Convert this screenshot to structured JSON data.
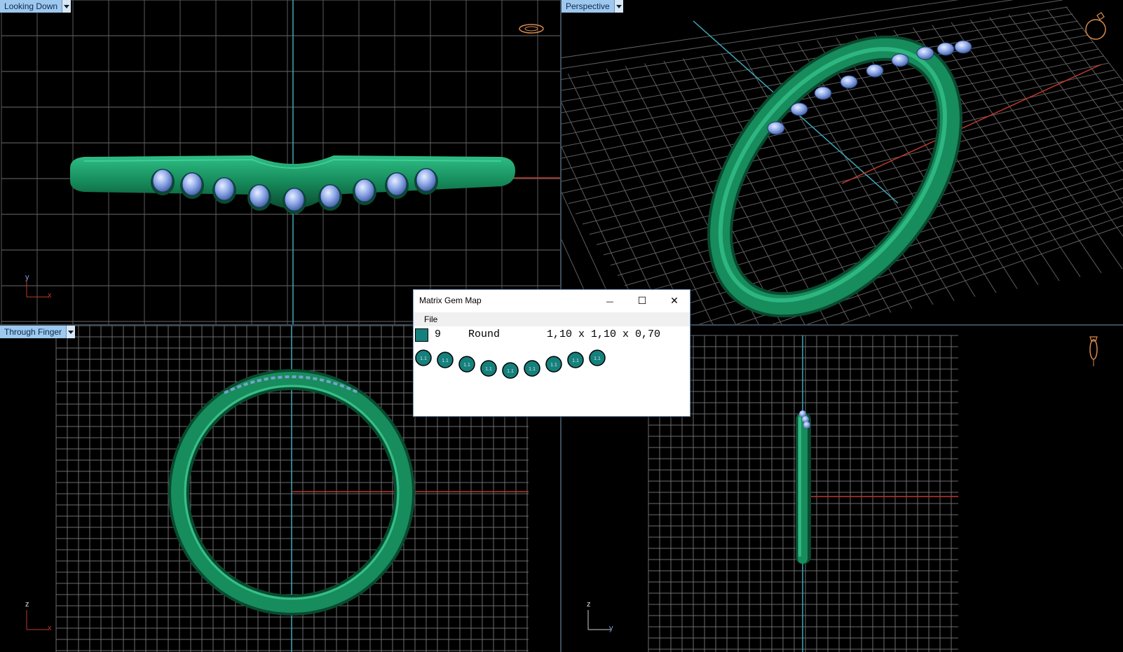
{
  "viewports": {
    "top_left": {
      "label": "Looking Down",
      "axes": {
        "v": "y",
        "h": "x"
      }
    },
    "top_right": {
      "label": "Perspective"
    },
    "bottom_left": {
      "label": "Through Finger",
      "axes": {
        "v": "z",
        "h": "x"
      }
    },
    "bottom_right": {
      "axes": {
        "v": "z",
        "h": "y"
      }
    }
  },
  "dialog": {
    "title": "Matrix Gem Map",
    "minimize_glyph": "—",
    "maximize_glyph": "☐",
    "close_glyph": "✕",
    "menu": {
      "file": "File"
    },
    "gem_row": {
      "count": "9",
      "shape": "Round",
      "size": "1,10 x 1,10 x 0,70",
      "swatch_color": "#16807c"
    },
    "gem_map": {
      "gem_label": "1.1",
      "count": 9
    }
  },
  "colors": {
    "ring_green": "#1f8a5c",
    "gem_blue": "#8ea8e8",
    "grid": "#6d6d6d",
    "axis_red": "#c0392b",
    "axis_cyan": "#3fa7b8"
  },
  "icons": {
    "top_left": "ring-side-icon",
    "top_right": "ring-perspective-icon",
    "bottom_right": "ring-standing-icon"
  }
}
